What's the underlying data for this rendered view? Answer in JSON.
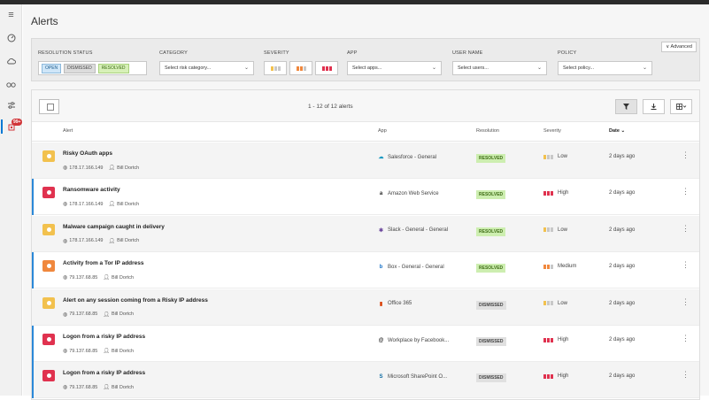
{
  "page": {
    "title": "Alerts"
  },
  "sidebar": {
    "items": [
      {
        "name": "menu-icon",
        "glyph": "≡"
      },
      {
        "name": "dashboard-icon",
        "glyph": "◷"
      },
      {
        "name": "cloud-icon",
        "glyph": "☁"
      },
      {
        "name": "investigate-icon",
        "glyph": "∞"
      },
      {
        "name": "control-icon",
        "glyph": "⚟"
      },
      {
        "name": "alerts-icon",
        "glyph": "♦",
        "badge": "99+"
      }
    ]
  },
  "filters": {
    "resolution_status": {
      "label": "RESOLUTION STATUS",
      "options": [
        "OPEN",
        "DISMISSED",
        "RESOLVED"
      ]
    },
    "category": {
      "label": "CATEGORY",
      "placeholder": "Select risk category..."
    },
    "severity": {
      "label": "SEVERITY"
    },
    "app": {
      "label": "APP",
      "placeholder": "Select apps..."
    },
    "user_name": {
      "label": "USER NAME",
      "placeholder": "Select users..."
    },
    "policy": {
      "label": "POLICY",
      "placeholder": "Select policy..."
    },
    "advanced": "Advanced"
  },
  "toolbar": {
    "count": "1 - 12 of 12 alerts"
  },
  "columns": {
    "alert": "Alert",
    "app": "App",
    "resolution": "Resolution",
    "severity": "Severity",
    "date": "Date"
  },
  "colors": {
    "low": "#f2c14e",
    "medium": "#f0883e",
    "high": "#e0324f",
    "grey": "#c8c8c8"
  },
  "alerts": [
    {
      "name": "Risky OAuth apps",
      "ip": "178.17.166.149",
      "user": "Bill Dortch",
      "app": "Salesforce - General",
      "app_icon": "☁",
      "app_color": "#1798c1",
      "resolution": "RESOLVED",
      "severity": "Low",
      "date": "2 days ago"
    },
    {
      "name": "Ransomware activity",
      "ip": "178.17.166.149",
      "user": "Bill Dortch",
      "app": "Amazon Web Service",
      "app_icon": "a",
      "app_color": "#222222",
      "resolution": "RESOLVED",
      "severity": "High",
      "date": "2 days ago"
    },
    {
      "name": "Malware campaign caught in delivery",
      "ip": "178.17.166.149",
      "user": "Bill Dortch",
      "app": "Slack - General - General",
      "app_icon": "✱",
      "app_color": "#6e4a9e",
      "resolution": "RESOLVED",
      "severity": "Low",
      "date": "2 days ago"
    },
    {
      "name": "Activity from a Tor IP address",
      "ip": "79.137.68.85",
      "user": "Bill Dortch",
      "app": "Box - General - General",
      "app_icon": "b",
      "app_color": "#1a73c8",
      "resolution": "RESOLVED",
      "severity": "Medium",
      "date": "2 days ago"
    },
    {
      "name": "Alert on any session coming from a Risky IP address",
      "ip": "79.137.68.85",
      "user": "Bill Dortch",
      "app": "Office 365",
      "app_icon": "▮",
      "app_color": "#d83b01",
      "resolution": "DISMISSED",
      "severity": "Low",
      "date": "2 days ago"
    },
    {
      "name": "Logon from a risky IP address",
      "ip": "79.137.68.85",
      "user": "Bill Dortch",
      "app": "Workplace by Facebook...",
      "app_icon": "@",
      "app_color": "#222222",
      "resolution": "DISMISSED",
      "severity": "High",
      "date": "2 days ago"
    },
    {
      "name": "Logon from a risky IP address",
      "ip": "79.137.68.85",
      "user": "Bill Dortch",
      "app": "Microsoft SharePoint O...",
      "app_icon": "S",
      "app_color": "#0b6aa2",
      "resolution": "DISMISSED",
      "severity": "High",
      "date": "2 days ago"
    }
  ]
}
